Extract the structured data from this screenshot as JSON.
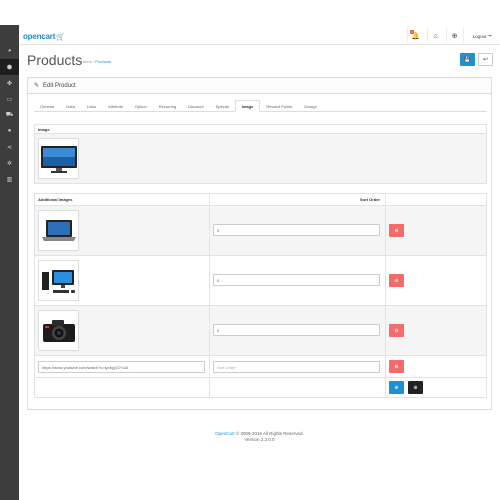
{
  "header": {
    "logo_text": "opencart",
    "alert_count": "9",
    "logout_label": "Logout"
  },
  "sidebar": {
    "items": [
      {
        "icon": "dashboard-icon",
        "glyph": "◕"
      },
      {
        "icon": "tags-icon",
        "glyph": "⬢",
        "active": true
      },
      {
        "icon": "puzzle-icon",
        "glyph": "✤"
      },
      {
        "icon": "desktop-icon",
        "glyph": "▭"
      },
      {
        "icon": "shopping-cart-icon",
        "glyph": "⛟"
      },
      {
        "icon": "user-icon",
        "glyph": "●"
      },
      {
        "icon": "share-icon",
        "glyph": "⋖"
      },
      {
        "icon": "cog-icon",
        "glyph": "✲"
      },
      {
        "icon": "bar-chart-icon",
        "glyph": "▥"
      }
    ]
  },
  "page": {
    "title": "Products",
    "breadcrumb_home": "Home",
    "breadcrumb_separator": "›",
    "breadcrumb_current": "Products"
  },
  "panel": {
    "heading": "Edit Product",
    "tabs": [
      {
        "label": "General"
      },
      {
        "label": "Data"
      },
      {
        "label": "Links"
      },
      {
        "label": "Attribute"
      },
      {
        "label": "Option"
      },
      {
        "label": "Recurring"
      },
      {
        "label": "Discount"
      },
      {
        "label": "Special"
      },
      {
        "label": "Image",
        "active": true
      },
      {
        "label": "Reward Points"
      },
      {
        "label": "Design"
      }
    ]
  },
  "image_section": {
    "header": "Image",
    "main_image": "monitor"
  },
  "additional_images": {
    "col_images": "Additional Images",
    "col_sort": "Sort Order",
    "rows": [
      {
        "image": "laptop",
        "sort_order": "0"
      },
      {
        "image": "desktop-pc",
        "sort_order": "0"
      },
      {
        "image": "camera",
        "sort_order": "0"
      }
    ],
    "video_row": {
      "url": "https://www.youtube.com/watch?v=lyoKjy0ZYUA",
      "sort_placeholder": "Sort Order"
    }
  },
  "footer": {
    "brand_link": "OpenCart",
    "copyright": "© 2009-2016 All Rights Reserved.",
    "version": "Version 2.2.0.0"
  },
  "colors": {
    "primary": "#1e91cf",
    "danger": "#f56b6b",
    "sidebar_bg": "#3d3d3d"
  }
}
